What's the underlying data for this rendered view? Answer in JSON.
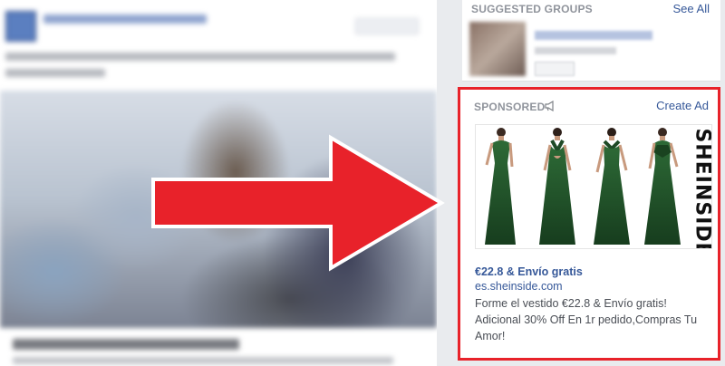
{
  "right_rail": {
    "suggested_groups": {
      "header": "SUGGESTED GROUPS",
      "see_all": "See All"
    },
    "sponsored": {
      "header": "SPONSORED",
      "header_icon": "megaphone-icon",
      "create_ad": "Create Ad",
      "ad": {
        "brand": "SHEINSIDE",
        "headline": "€22.8 & Envío gratis",
        "domain": "es.sheinside.com",
        "body": "Forme el vestido €22.8 & Envío gratis! Adicional 30% Off En 1r pedido,Compras Tu Amor!"
      }
    }
  },
  "colors": {
    "annotation_red": "#e8222a",
    "facebook_link": "#365899",
    "dress_green": "#1f4a26"
  }
}
